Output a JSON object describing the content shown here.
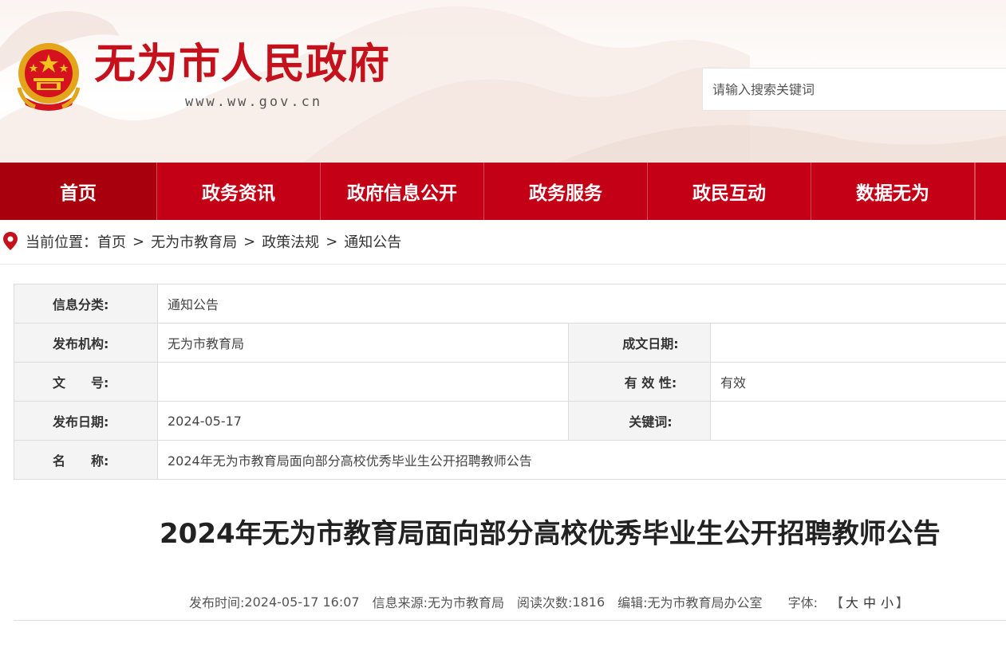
{
  "header": {
    "site_title": "无为市人民政府",
    "site_url": "www.ww.gov.cn",
    "search_placeholder": "请输入搜索关键词",
    "brand_color": "#c4111c"
  },
  "nav": {
    "items": [
      {
        "label": "首页",
        "active": true
      },
      {
        "label": "政务资讯"
      },
      {
        "label": "政府信息公开"
      },
      {
        "label": "政务服务"
      },
      {
        "label": "政民互动"
      },
      {
        "label": "数据无为"
      }
    ],
    "bg_color": "#c30016",
    "active_color": "#a9000d"
  },
  "breadcrumb": {
    "prefix": "当前位置：",
    "items": [
      "首页",
      "无为市教育局",
      "政策法规",
      "通知公告"
    ],
    "separator": ">",
    "icon": "location-pin-icon"
  },
  "info_table": {
    "category_label": "信息分类:",
    "category_value": "通知公告",
    "publisher_label": "发布机构:",
    "publisher_value": "无为市教育局",
    "written_date_label": "成文日期:",
    "written_date_value": "",
    "doc_no_label": "文　　号:",
    "doc_no_value": "",
    "validity_label": "有 效 性:",
    "validity_value": "有效",
    "publish_date_label": "发布日期:",
    "publish_date_value": "2024-05-17",
    "keywords_label": "关键词:",
    "keywords_value": "",
    "name_label": "名　　称:",
    "name_value": "2024年无为市教育局面向部分高校优秀毕业生公开招聘教师公告"
  },
  "article": {
    "title": "2024年无为市教育局面向部分高校优秀毕业生公开招聘教师公告",
    "meta": {
      "publish_time_label": "发布时间:",
      "publish_time": "2024-05-17 16:07",
      "source_label": "信息来源:",
      "source": "无为市教育局",
      "views_label": "阅读次数:",
      "views": "1816",
      "editor_label": "编辑:",
      "editor": "无为市教育局办公室",
      "font_label": "字体:",
      "font_open": "【",
      "font_large": "大",
      "font_medium": "中",
      "font_small": "小",
      "font_close": "】"
    }
  }
}
